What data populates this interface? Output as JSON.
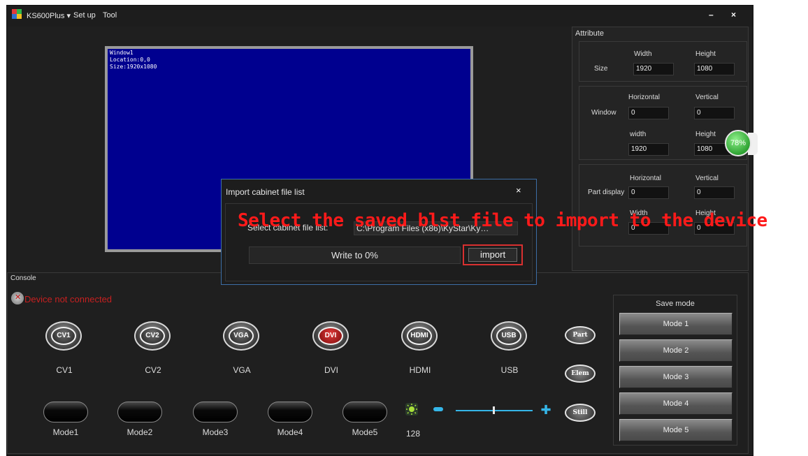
{
  "titlebar": {
    "menu": [
      "KS600Plus ▾",
      "Set up",
      "Tool"
    ],
    "minimize": "–",
    "close": "×"
  },
  "preview": {
    "window_info": "Window1\nLocation:0,0\nSize:1920x1080"
  },
  "attribute": {
    "title": "Attribute",
    "size": {
      "label": "Size",
      "width_label": "Width",
      "height_label": "Height",
      "width": "1920",
      "height": "1080"
    },
    "window": {
      "label": "Window",
      "horizontal_label": "Horizontal",
      "vertical_label": "Vertical",
      "horizontal": "0",
      "vertical": "0",
      "width_label": "width",
      "height_label": "Height",
      "width": "1920",
      "height": "1080"
    },
    "part_display": {
      "label": "Part display",
      "horizontal_label": "Horizontal",
      "vertical_label": "Vertical",
      "horizontal": "0",
      "vertical": "0",
      "width_label": "Width",
      "height_label": "Height",
      "width": "0",
      "height": "0"
    }
  },
  "badge": {
    "percent": "78%"
  },
  "console": {
    "title": "Console",
    "status": "Device not connected",
    "sources": [
      {
        "icon": "CV1",
        "label": "CV1"
      },
      {
        "icon": "CV2",
        "label": "CV2"
      },
      {
        "icon": "VGA",
        "label": "VGA"
      },
      {
        "icon": "DVI",
        "label": "DVI"
      },
      {
        "icon": "HDMI",
        "label": "HDMI"
      },
      {
        "icon": "USB",
        "label": "USB"
      }
    ],
    "side_buttons": [
      "Part",
      "Elem",
      "Still"
    ],
    "modes": [
      "Mode1",
      "Mode2",
      "Mode3",
      "Mode4",
      "Mode5"
    ],
    "brightness": "128"
  },
  "save_mode": {
    "title": "Save mode",
    "buttons": [
      "Mode 1",
      "Mode 2",
      "Mode 3",
      "Mode 4",
      "Mode 5"
    ]
  },
  "dialog": {
    "title": "Import cabinet file list",
    "close": "×",
    "select_label": "Select cabinet file list:",
    "path": "C:\\Program Files (x86)\\KyStar\\Ky…",
    "progress": "Write to 0%",
    "import_label": "import"
  },
  "annotation": "Select the saved blst file to import to the device",
  "colors": {
    "canvas": "#00008f",
    "status_error": "#c62020",
    "accent": "#35b6e8",
    "highlight": "#d93030"
  }
}
